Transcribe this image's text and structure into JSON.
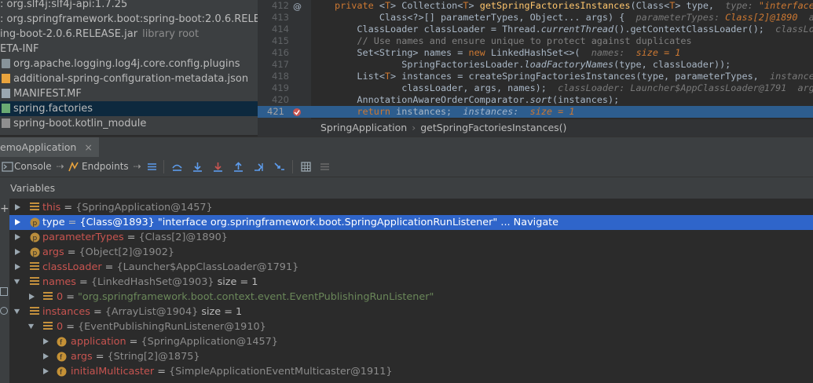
{
  "project_tree": {
    "items": [
      {
        "label": ": org.slf4j:slf4j-api:1.7.25",
        "icon": "library-icon"
      },
      {
        "label": ": org.springframework.boot:spring-boot:2.0.6.RELEA",
        "icon": "library-icon"
      },
      {
        "label": "ing-boot-2.0.6.RELEASE.jar",
        "hint": "library root",
        "icon": "jar-icon"
      },
      {
        "label": "ETA-INF",
        "icon": "folder-icon"
      },
      {
        "label": "org.apache.logging.log4j.core.config.plugins",
        "icon": "folder-icon"
      },
      {
        "label": "additional-spring-configuration-metadata.json",
        "icon": "json-icon"
      },
      {
        "label": "MANIFEST.MF",
        "icon": "manifest-icon"
      },
      {
        "label": "spring.factories",
        "icon": "spring-icon",
        "selected": true
      },
      {
        "label": "spring-boot.kotlin_module",
        "icon": "file-icon"
      }
    ]
  },
  "editor": {
    "line_numbers": [
      "412",
      "413",
      "414",
      "415",
      "416",
      "417",
      "418",
      "419",
      "420",
      "421"
    ],
    "current_line": "421",
    "lines": [
      {
        "kw1": "private ",
        "p1": "<",
        "t1": "T",
        "p2": "> Collection<",
        "t2": "T",
        "p3": "> ",
        "fn": "getSpringFactoriesInstances",
        "p4": "(Class<",
        "t3": "T",
        "p5": "> type,  ",
        "h1": "type: ",
        "hv1": "\"interface"
      },
      {
        "p1": "        Class<?>[] parameterTypes, Object... args) {  ",
        "h1": "parameterTypes: ",
        "hv1": "Class[2]@1890",
        "h2": "  arg"
      },
      {
        "p1": "    ClassLoader classLoader = Thread.",
        "it1": "currentThread",
        "p2": "().getContextClassLoader();  ",
        "h1": "classLoa"
      },
      {
        "cm": "    // Use names and ensure unique to protect against duplicates"
      },
      {
        "p1": "    Set<String> names = ",
        "kw1": "new ",
        "p2": "LinkedHashSet<>(  ",
        "h1": "names:  ",
        "hv1": "size = 1"
      },
      {
        "p1": "            SpringFactoriesLoader.",
        "it1": "loadFactoryNames",
        "p2": "(type, classLoader));"
      },
      {
        "p1": "    List<",
        "t1": "T",
        "p2": "> instances = createSpringFactoriesInstances(type, parameterTypes,  ",
        "h1": "instances"
      },
      {
        "p1": "            classLoader, args, names);  ",
        "h1": "classLoader: Launcher$AppClassLoader@1791  args"
      },
      {
        "p1": "    AnnotationAwareOrderComparator.",
        "it1": "sort",
        "p2": "(instances);"
      },
      {
        "kw1": "    return ",
        "p1": "instances;  ",
        "h1": "instances:  ",
        "hv1": "size = 1"
      }
    ],
    "breadcrumb": [
      "SpringApplication",
      "getSpringFactoriesInstances()"
    ]
  },
  "debug": {
    "tab_label": "emoApplication",
    "toolbar": {
      "console_label": "Console",
      "endpoints_label": "Endpoints"
    },
    "variables_label": "Variables",
    "variables": [
      {
        "name": "this",
        "value": "{SpringApplication@1457}",
        "icon": "field-list-icon",
        "expand": "right",
        "indent": 0
      },
      {
        "name": "type",
        "value": "{Class@1893} \"interface org.springframework.boot.SpringApplicationRunListener\" ... Navigate",
        "icon": "param-icon",
        "expand": "right",
        "indent": 0,
        "selected": true
      },
      {
        "name": "parameterTypes",
        "value": "{Class[2]@1890}",
        "icon": "param-icon",
        "expand": "right",
        "indent": 0
      },
      {
        "name": "args",
        "value": "{Object[2]@1902}",
        "icon": "param-icon",
        "expand": "right",
        "indent": 0
      },
      {
        "name": "classLoader",
        "value": "{Launcher$AppClassLoader@1791}",
        "icon": "field-list-icon",
        "expand": "right",
        "indent": 0
      },
      {
        "name": "names",
        "value": "{LinkedHashSet@1903}",
        "size": "size = 1",
        "icon": "field-list-icon",
        "expand": "down",
        "indent": 0
      },
      {
        "name": "0",
        "value": "\"org.springframework.boot.context.event.EventPublishingRunListener\"",
        "icon": "field-list-icon",
        "expand": "right",
        "indent": 1,
        "string": true
      },
      {
        "name": "instances",
        "value": "{ArrayList@1904}",
        "size": "size = 1",
        "icon": "field-list-icon",
        "expand": "down",
        "indent": 0
      },
      {
        "name": "0",
        "value": "{EventPublishingRunListener@1910}",
        "icon": "field-list-icon",
        "expand": "down",
        "indent": 1
      },
      {
        "name": "application",
        "value": "{SpringApplication@1457}",
        "icon": "field-icon",
        "expand": "right",
        "indent": 2
      },
      {
        "name": "args",
        "value": "{String[2]@1875}",
        "icon": "field-icon",
        "expand": "right",
        "indent": 2
      },
      {
        "name": "initialMulticaster",
        "value": "{SimpleApplicationEventMulticaster@1911}",
        "icon": "field-icon",
        "expand": "right",
        "indent": 2
      }
    ]
  },
  "colors": {
    "selection": "#2f65ca",
    "var_name": "#c75450",
    "keyword": "#cc7832",
    "function": "#ffc66d",
    "string": "#6a8759",
    "current_line": "#2d5d8e"
  }
}
